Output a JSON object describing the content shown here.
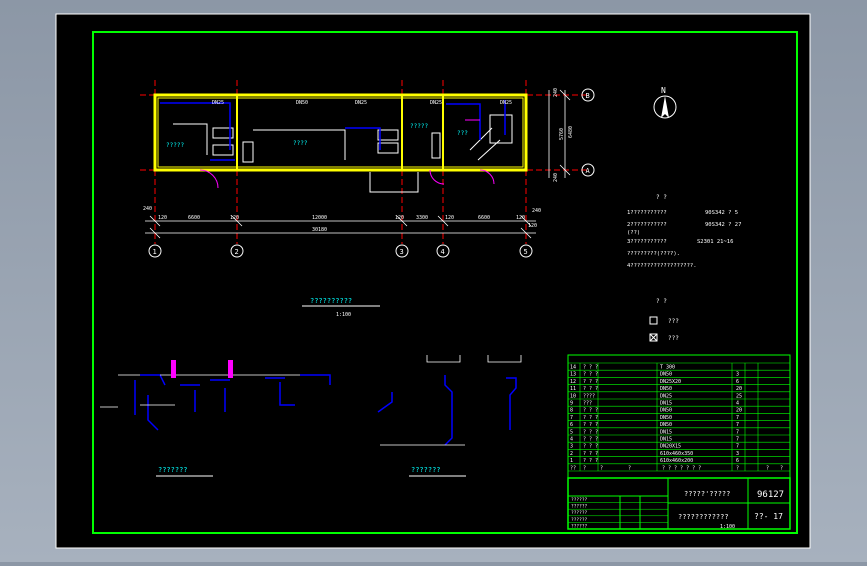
{
  "colors": {
    "background": "#000000",
    "frame": "#00ff00",
    "wall": "#ffff00",
    "axis": "#ff0000",
    "text": "#ffffff",
    "pipe": "#0000ff",
    "label_cyan": "#00ffff",
    "magenta": "#ff00ff"
  },
  "grid_axes": {
    "columns": [
      "1",
      "2",
      "3",
      "4",
      "5"
    ],
    "rows": [
      "B",
      "A"
    ]
  },
  "dimensions": {
    "segments": [
      "6600",
      "12000",
      "3300",
      "6600"
    ],
    "total": "30180",
    "offsets_left": [
      "240",
      "120"
    ],
    "offsets_right": [
      "120",
      "240"
    ],
    "inner_offsets": [
      "120",
      "120",
      "120",
      "120"
    ],
    "vertical": [
      "5760",
      "6480"
    ],
    "vertical_edge": [
      "240",
      "240"
    ]
  },
  "plan": {
    "room_labels": [
      "?????",
      "????",
      "?????",
      "???"
    ],
    "top_labels": [
      "DN25",
      "DN50",
      "DN25",
      "DN25",
      "DN25"
    ],
    "caption": "??????????",
    "scale": "1:100"
  },
  "notes": {
    "title": "?  ?",
    "lines": [
      "1???????????",
      "2???????????",
      "(??)",
      "3???????????",
      "  ?????????(????).",
      "4???????????????????."
    ],
    "refs": [
      "90S342 ? 5",
      "90S342 ? 27",
      "S2301 21~16"
    ]
  },
  "compass": {
    "label": "N"
  },
  "legend": {
    "title": "?  ?",
    "items": [
      "???",
      "???"
    ]
  },
  "system": {
    "caption_left": "???????",
    "caption_right": "???????"
  },
  "bom": {
    "rows": [
      [
        "14",
        "? ? ?",
        "T 300",
        "",
        "",
        ""
      ],
      [
        "13",
        "? ? ?",
        "DN50",
        "1",
        "3",
        ""
      ],
      [
        "12",
        "? ? ?",
        "DN25X20",
        "1",
        "6",
        ""
      ],
      [
        "11",
        "? ? ?",
        "DN50",
        "1",
        "20",
        ""
      ],
      [
        "10",
        "????",
        "DN25",
        "1",
        "25",
        ""
      ],
      [
        "9",
        "???",
        "DN15",
        "1",
        "4",
        ""
      ],
      [
        "8",
        "? ? ?",
        "DN50",
        "1",
        "20",
        ""
      ],
      [
        "7",
        "? ? ?",
        "DN50",
        "1",
        "7",
        ""
      ],
      [
        "6",
        "? ? ?",
        "DN50",
        "1",
        "7",
        ""
      ],
      [
        "5",
        "? ? ?",
        "DN15",
        "1",
        "7",
        ""
      ],
      [
        "4",
        "? ? ?",
        "DN15",
        "1",
        "7",
        ""
      ],
      [
        "3",
        "? ? ?",
        "DN20X15",
        "1",
        "7",
        ""
      ],
      [
        "2",
        "? ? ?",
        "610x460x350",
        "1",
        "3",
        ""
      ],
      [
        "1",
        "? ? ?",
        "610x460x200",
        "1",
        "6",
        ""
      ]
    ],
    "header": [
      "??",
      "?",
      "?",
      "?",
      "? ? ? ? ? ? ?",
      "?",
      "?",
      "?"
    ]
  },
  "title_block": {
    "drawing_title": "?????'?????",
    "project": "????????????",
    "code": "96127",
    "sheet": "??- 17",
    "scale": "1:100",
    "sign_rows": [
      "??????",
      "??????",
      "??????",
      "??????",
      "??????"
    ]
  }
}
